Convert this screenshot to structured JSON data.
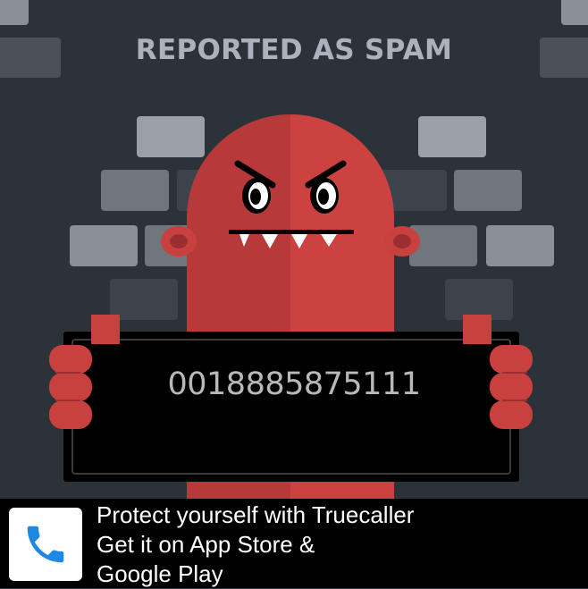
{
  "header": {
    "title": "REPORTED AS SPAM"
  },
  "spam_card": {
    "phone_number": "0018885875111"
  },
  "banner": {
    "icon": "phone-icon",
    "line1": "Protect yourself with Truecaller",
    "line2": "Get it on App Store &",
    "line3": "Google Play"
  },
  "colors": {
    "background": "#2b3238",
    "monster_red": "#c8413f",
    "sign_black": "#000000",
    "brick_light": "#8a9096",
    "brick_dark": "#3c444b",
    "phone_blue": "#1e88e5"
  }
}
